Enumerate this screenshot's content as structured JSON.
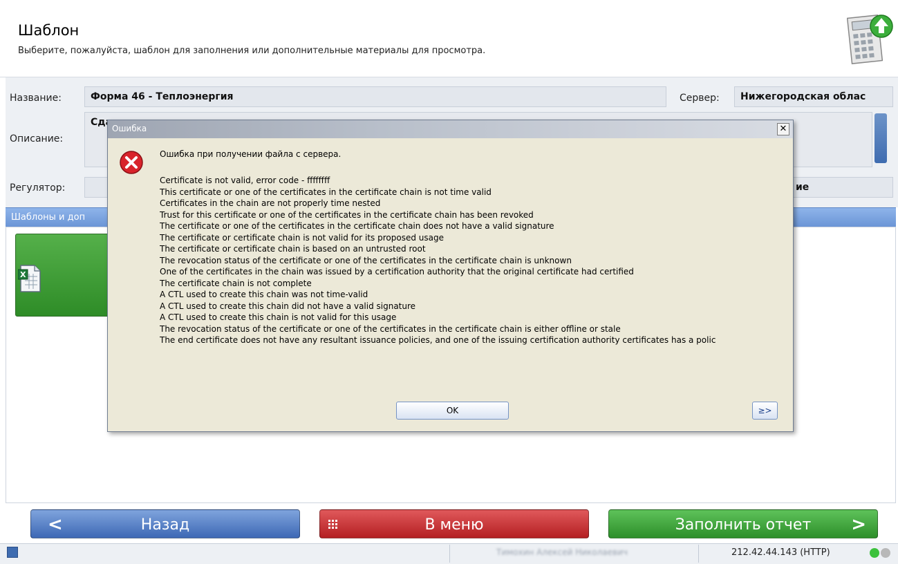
{
  "header": {
    "title": "Шаблон",
    "subtitle": "Выберите, пожалуйста, шаблон для заполнения или дополнительные материалы для просмотра.",
    "icon": "calculator-upload-icon"
  },
  "form": {
    "name_label": "Название:",
    "name_value": "Форма 46 - Теплоэнергия",
    "server_label": "Сервер:",
    "server_value": "Нижегородская облас",
    "description_label": "Описание:",
    "description_value": "Сда",
    "regulator_label": "Регулятор:",
    "regulator_value": "ие"
  },
  "templates_panel": {
    "title": "Шаблоны и доп",
    "tile_icon": "excel-document-icon"
  },
  "buttons": {
    "back": "Назад",
    "menu": "В меню",
    "fill": "Заполнить отчет"
  },
  "statusbar": {
    "user": "Тимохин Алексей Николаевич",
    "connection": "212.42.44.143 (HTTP)",
    "status_colors": [
      "#3cc13c",
      "#b8b8b8"
    ]
  },
  "dialog": {
    "title": "Ошибка",
    "icon": "error-icon",
    "message": "Ошибка при получении файла с сервера.",
    "lines": [
      "Certificate is not valid, error code - ffffffff",
      "This certificate or one of the certificates in the certificate chain is not time valid",
      "Certificates in the chain are not properly time nested",
      "Trust for this certificate or one of the certificates in the certificate chain has been revoked",
      "The certificate or one of the certificates in the certificate chain does not have a valid signature",
      "The certificate or certificate chain is not valid for its proposed usage",
      "The certificate or certificate chain is based on an untrusted root",
      "The revocation status of the certificate or one of the certificates in the certificate chain is unknown",
      "One of the certificates in the chain was issued by a certification authority that the original certificate had certified",
      "The certificate chain is not complete",
      "A CTL used to create this chain was not time-valid",
      "A CTL used to create this chain did not have a valid signature",
      "A CTL used to create this chain is not valid for this usage",
      "The revocation status of the certificate or one of the certificates in the certificate chain is either offline or stale",
      "The end certificate does not have any resultant issuance policies, and one of the issuing certification authority certificates has a polic"
    ],
    "ok_label": "OK",
    "details_label": "≥>"
  }
}
